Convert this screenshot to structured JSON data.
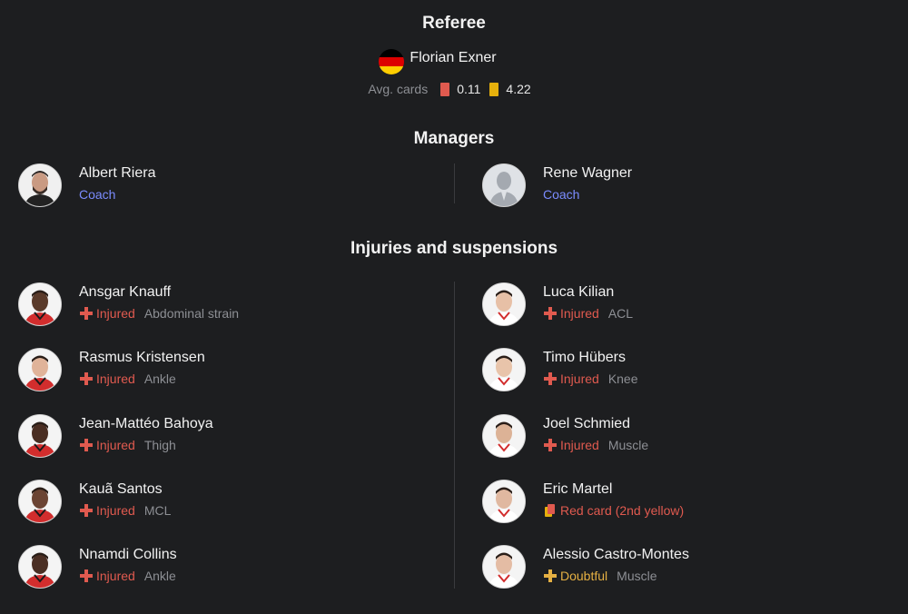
{
  "referee": {
    "title": "Referee",
    "name": "Florian Exner",
    "flag_colors": [
      "#000000",
      "#dd0000",
      "#ffce00"
    ],
    "avg_cards_label": "Avg. cards",
    "red_avg": "0.11",
    "yellow_avg": "4.22"
  },
  "colors": {
    "red_card": "#e05a4f",
    "yellow_card": "#e5b00c",
    "injured": "#e05a4f",
    "doubtful": "#e5b043",
    "coach": "#7b8cff"
  },
  "managers": {
    "title": "Managers",
    "home": {
      "name": "Albert Riera",
      "role": "Coach"
    },
    "away": {
      "name": "Rene Wagner",
      "role": "Coach"
    }
  },
  "injuries": {
    "title": "Injuries and suspensions",
    "home": [
      {
        "name": "Ansgar Knauff",
        "status": "Injured",
        "detail": "Abdominal strain",
        "icon": "injured-cross-icon"
      },
      {
        "name": "Rasmus Kristensen",
        "status": "Injured",
        "detail": "Ankle",
        "icon": "injured-cross-icon"
      },
      {
        "name": "Jean-Mattéo Bahoya",
        "status": "Injured",
        "detail": "Thigh",
        "icon": "injured-cross-icon"
      },
      {
        "name": "Kauã Santos",
        "status": "Injured",
        "detail": "MCL",
        "icon": "injured-cross-icon"
      },
      {
        "name": "Nnamdi Collins",
        "status": "Injured",
        "detail": "Ankle",
        "icon": "injured-cross-icon"
      }
    ],
    "away": [
      {
        "name": "Luca Kilian",
        "status": "Injured",
        "detail": "ACL",
        "icon": "injured-cross-icon"
      },
      {
        "name": "Timo Hübers",
        "status": "Injured",
        "detail": "Knee",
        "icon": "injured-cross-icon"
      },
      {
        "name": "Joel Schmied",
        "status": "Injured",
        "detail": "Muscle",
        "icon": "injured-cross-icon"
      },
      {
        "name": "Eric Martel",
        "status": "Red card (2nd yellow)",
        "detail": "",
        "icon": "red-card-icon"
      },
      {
        "name": "Alessio Castro-Montes",
        "status": "Doubtful",
        "detail": "Muscle",
        "icon": "doubtful-cross-icon"
      }
    ]
  }
}
